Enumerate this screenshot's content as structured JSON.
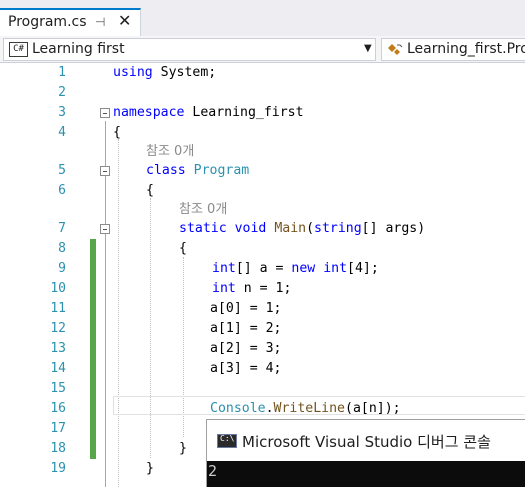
{
  "tab": {
    "title": "Program.cs",
    "pin_glyph": "⊣",
    "close_glyph": "✕"
  },
  "navbar": {
    "project_icon": "C#",
    "project": "Learning first",
    "member": "Learning_first.Program"
  },
  "editor": {
    "lines": [
      {
        "n": "1"
      },
      {
        "n": "2"
      },
      {
        "n": "3"
      },
      {
        "n": "4"
      },
      {
        "n": "5"
      },
      {
        "n": "6"
      },
      {
        "n": "7"
      },
      {
        "n": "8"
      },
      {
        "n": "9"
      },
      {
        "n": "10"
      },
      {
        "n": "11"
      },
      {
        "n": "12"
      },
      {
        "n": "13"
      },
      {
        "n": "14"
      },
      {
        "n": "15"
      },
      {
        "n": "16"
      },
      {
        "n": "17"
      },
      {
        "n": "18"
      },
      {
        "n": "19"
      }
    ],
    "tokens": {
      "l1_using": "using",
      "l1_rest": " System;",
      "l3_namespace": "namespace",
      "l3_rest": " Learning_first",
      "l4": "{",
      "hint_class": "참조 0개",
      "l5_class": "class",
      "l5_name": "Program",
      "l6": "{",
      "hint_main": "참조 0개",
      "l7_static": "static",
      "l7_void": "void",
      "l7_main": "Main",
      "l7_paren": "(",
      "l7_string": "string",
      "l7_rest": "[] args)",
      "l8": "{",
      "l9_int": "int",
      "l9_mid": "[] a = ",
      "l9_new": "new",
      "l9_int2": "int",
      "l9_rest": "[4];",
      "l10_int": "int",
      "l10_rest": " n = 1;",
      "l11": "a[0] = 1;",
      "l12": "a[1] = 2;",
      "l13": "a[2] = 3;",
      "l14": "a[3] = 4;",
      "l16_console": "Console",
      "l16_dot": ".",
      "l16_write": "WriteLine",
      "l16_rest": "(a[n]);",
      "l18": "}",
      "l19": "}"
    }
  },
  "console": {
    "icon_label": "C:\\",
    "title": "Microsoft Visual Studio 디버그 콘솔",
    "output": "2"
  },
  "colors": {
    "accent": "#007acc",
    "keyword": "#0000ff",
    "type": "#2b91af",
    "method": "#74531f",
    "changed_margin": "#57a64a"
  }
}
